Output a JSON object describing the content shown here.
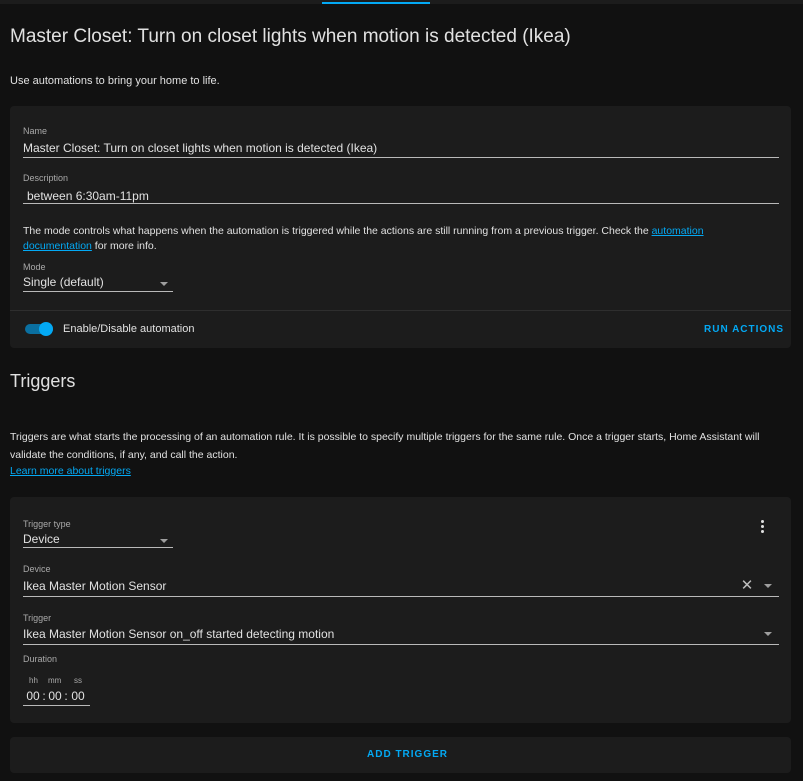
{
  "header": {
    "title": "Master Closet: Turn on closet lights when motion is detected (Ikea)",
    "intro": "Use automations to bring your home to life."
  },
  "settings": {
    "name_label": "Name",
    "name_value": "Master Closet: Turn on closet lights when motion is detected (Ikea)",
    "description_label": "Description",
    "description_value": "between 6:30am-11pm",
    "mode_help_before": "The mode controls what happens when the automation is triggered while the actions are still running from a previous trigger. Check the ",
    "mode_help_link": "automation documentation",
    "mode_help_after": " for more info.",
    "mode_label": "Mode",
    "mode_value": "Single (default)",
    "toggle_label": "Enable/Disable automation",
    "toggle_on": true,
    "run_actions_label": "RUN ACTIONS"
  },
  "triggers": {
    "title": "Triggers",
    "description": "Triggers are what starts the processing of an automation rule. It is possible to specify multiple triggers for the same rule. Once a trigger starts, Home Assistant will validate the conditions, if any, and call the action.",
    "learn_more": "Learn more about triggers",
    "trigger_type_label": "Trigger type",
    "trigger_type_value": "Device",
    "device_label": "Device",
    "device_value": "Ikea Master Motion Sensor",
    "trigger_label": "Trigger",
    "trigger_value": "Ikea Master Motion Sensor on_off started detecting motion",
    "duration_label": "Duration",
    "duration_units": {
      "hh": "hh",
      "mm": "mm",
      "ss": "ss"
    },
    "duration_values": {
      "hh": "00",
      "mm": "00",
      "ss": "00"
    },
    "add_trigger_label": "ADD TRIGGER"
  },
  "icons": {
    "clear": "close-icon",
    "menu": "more-vertical-icon",
    "dropdown": "chevron-down-icon"
  },
  "colors": {
    "accent": "#03a9f4",
    "card": "#1c1c1c",
    "background": "#111111"
  }
}
